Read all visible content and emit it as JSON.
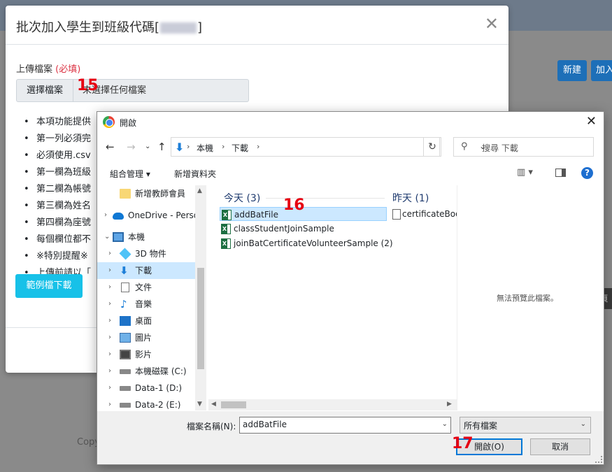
{
  "background": {
    "new_button": "新建",
    "add_button": "加入",
    "copyright_fragment": "Copy",
    "dark_button_fragment": "頁"
  },
  "modal": {
    "title_prefix": "批次加入學生到班級代碼[",
    "title_suffix": "]",
    "close_glyph": "✕",
    "upload_label": "上傳檔案",
    "required_label": "(必填)",
    "choose_file_button": "選擇檔案",
    "no_file_text": "未選擇任何檔案",
    "notes": [
      "本項功能提供",
      "第一列必須完",
      "必須使用.csv",
      "第一欄為班級",
      "第二欄為帳號",
      "第三欄為姓名",
      "第四欄為座號",
      "每個欄位都不",
      "※特別提醒※",
      "上傳前請以「"
    ],
    "sample_download_button": "範例檔下載"
  },
  "steps": {
    "step15": "15",
    "step16": "16",
    "step17": "17"
  },
  "dialog": {
    "title": "開啟",
    "close_glyph": "✕",
    "address": {
      "parts": [
        "本機",
        "下載"
      ]
    },
    "search_placeholder": "搜尋 下載",
    "toolbar": {
      "organize": "組合管理 ▾",
      "new_folder": "新增資料夾"
    },
    "nav_tree": [
      {
        "label": "新增教師會員",
        "icon": "folder-icon"
      },
      {
        "label": "OneDrive - Perso",
        "icon": "onedrive-icon"
      },
      {
        "label": "本機",
        "icon": "computer-icon"
      },
      {
        "label": "3D 物件",
        "icon": "3d-objects-icon"
      },
      {
        "label": "下載",
        "icon": "downloads-icon"
      },
      {
        "label": "文件",
        "icon": "documents-icon"
      },
      {
        "label": "音樂",
        "icon": "music-icon"
      },
      {
        "label": "桌面",
        "icon": "desktop-icon"
      },
      {
        "label": "圖片",
        "icon": "pictures-icon"
      },
      {
        "label": "影片",
        "icon": "videos-icon"
      },
      {
        "label": "本機磁碟 (C:)",
        "icon": "drive-icon"
      },
      {
        "label": "Data-1 (D:)",
        "icon": "drive-icon"
      },
      {
        "label": "Data-2 (E:)",
        "icon": "drive-icon"
      }
    ],
    "groups": {
      "today": "今天 (3)",
      "yesterday": "昨天 (1)"
    },
    "files_today": [
      "addBatFile",
      "classStudentJoinSample",
      "joinBatCertificateVolunteerSample (2)"
    ],
    "files_yesterday": [
      "certificateBoo"
    ],
    "preview_text": "無法預覽此檔案。",
    "filename_label": "檔案名稱(N):",
    "filename_value": "addBatFile",
    "filetype_value": "所有檔案",
    "open_button": "開啟(O)",
    "cancel_button": "取消"
  }
}
